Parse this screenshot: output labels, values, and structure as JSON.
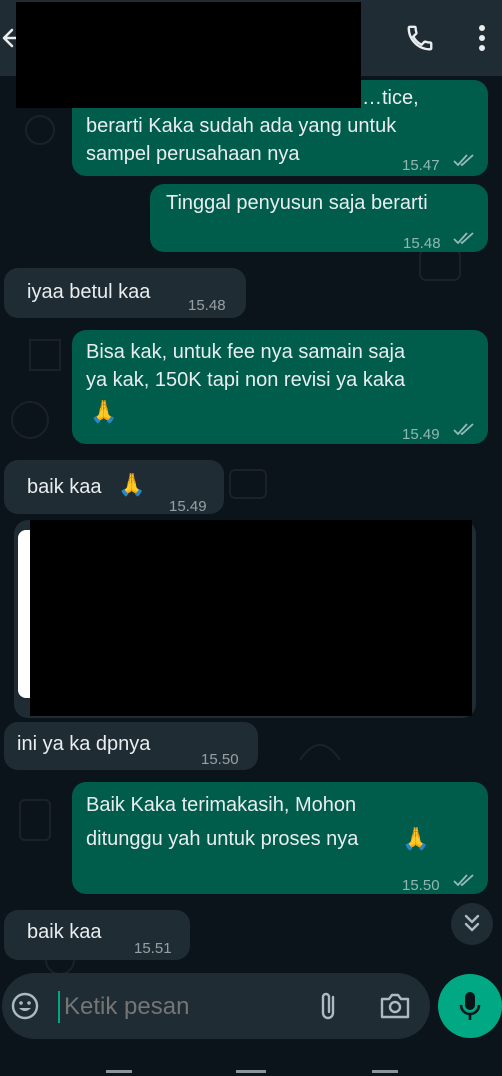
{
  "header": {
    "back_icon": "arrow-left-icon",
    "call_icon": "phone-icon",
    "menu_icon": "more-vertical-icon"
  },
  "messages": [
    {
      "dir": "out",
      "lines": [
        "…tice,",
        "berarti Kaka sudah ada yang untuk",
        "sampel perusahaan nya"
      ],
      "time": "15.47",
      "status": "read"
    },
    {
      "dir": "out",
      "lines": [
        "Tinggal penyusun saja berarti"
      ],
      "time": "15.48",
      "status": "read"
    },
    {
      "dir": "in",
      "lines": [
        "iyaa betul kaa"
      ],
      "time": "15.48"
    },
    {
      "dir": "out",
      "lines": [
        "Bisa kak, untuk fee nya samain saja",
        "ya kak, 150K tapi non revisi ya kaka"
      ],
      "emoji": "🙏",
      "time": "15.49",
      "status": "read"
    },
    {
      "dir": "in",
      "lines": [
        "baik kaa"
      ],
      "emoji": "🙏",
      "time": "15.49"
    },
    {
      "dir": "in",
      "lines": [
        "ini ya ka dpnya"
      ],
      "time": "15.50"
    },
    {
      "dir": "out",
      "lines": [
        "Baik Kaka terimakasih, Mohon",
        "ditunggu yah untuk proses nya"
      ],
      "emoji": "🙏",
      "time": "15.50",
      "status": "read"
    },
    {
      "dir": "in",
      "lines": [
        "baik kaa"
      ],
      "time": "15.51"
    }
  ],
  "composer": {
    "placeholder": "Ketik pesan",
    "emoji_icon": "emoji-icon",
    "attach_icon": "paperclip-icon",
    "camera_icon": "camera-icon",
    "mic_icon": "microphone-icon",
    "scroll_icon": "double-chevron-down-icon"
  },
  "colors": {
    "background": "#0b141a",
    "header": "#1f2c34",
    "outgoing_bubble": "#005c4b",
    "incoming_bubble": "#1f2c34",
    "accent": "#00a884"
  }
}
